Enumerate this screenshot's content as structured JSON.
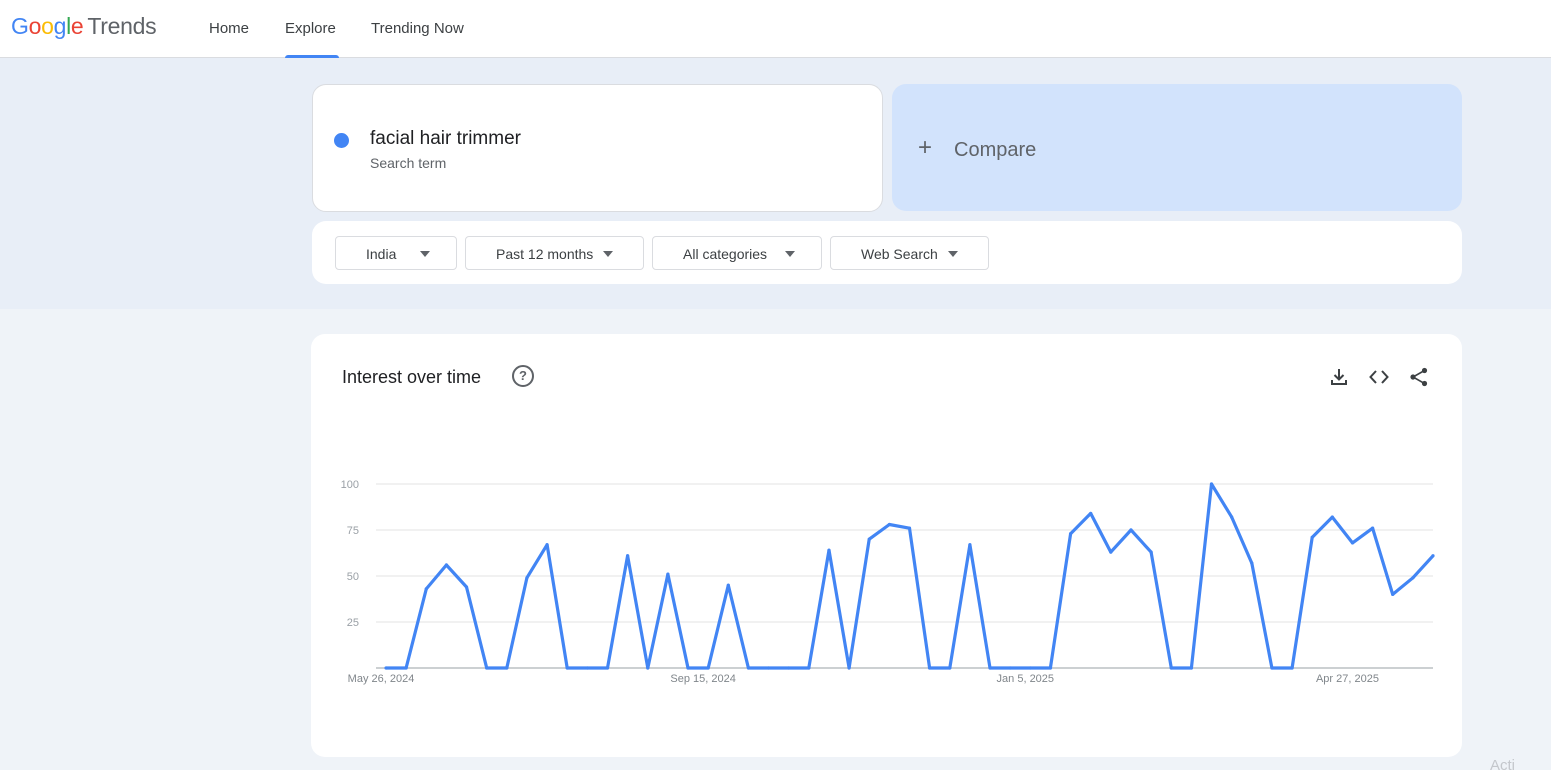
{
  "app": {
    "logo_google": "Google",
    "logo_trends": "Trends"
  },
  "nav": {
    "tabs": [
      {
        "label": "Home"
      },
      {
        "label": "Explore",
        "active": true
      },
      {
        "label": "Trending Now"
      }
    ]
  },
  "search": {
    "term": "facial hair trimmer",
    "term_type": "Search term",
    "term_color": "#4285f4",
    "compare_label": "Compare"
  },
  "filters": [
    {
      "label": "India"
    },
    {
      "label": "Past 12 months"
    },
    {
      "label": "All categories"
    },
    {
      "label": "Web Search"
    }
  ],
  "interest_over_time": {
    "title": "Interest over time",
    "icons": [
      "help-icon",
      "download-icon",
      "embed-code-icon",
      "share-icon"
    ]
  },
  "corner_text": "Acti",
  "chart_data": {
    "type": "line",
    "title": "Interest over time",
    "xlabel": "",
    "ylabel": "",
    "ylim": [
      0,
      100
    ],
    "yticks": [
      25,
      50,
      75,
      100
    ],
    "grid": true,
    "xtick_labels": [
      "May 26, 2024",
      "Sep 15, 2024",
      "Jan 5, 2025",
      "Apr 27, 2025"
    ],
    "x_start": "2024-05-26",
    "x_interval": "weekly",
    "color": "#4285f4",
    "series": [
      {
        "name": "facial hair trimmer",
        "values": [
          0,
          0,
          43,
          56,
          44,
          0,
          0,
          49,
          67,
          0,
          0,
          0,
          61,
          0,
          51,
          0,
          0,
          45,
          0,
          0,
          0,
          0,
          64,
          0,
          70,
          78,
          76,
          0,
          0,
          67,
          0,
          0,
          0,
          0,
          73,
          84,
          63,
          75,
          63,
          0,
          0,
          100,
          82,
          57,
          0,
          0,
          71,
          82,
          68,
          76,
          40,
          49,
          61
        ]
      }
    ]
  }
}
